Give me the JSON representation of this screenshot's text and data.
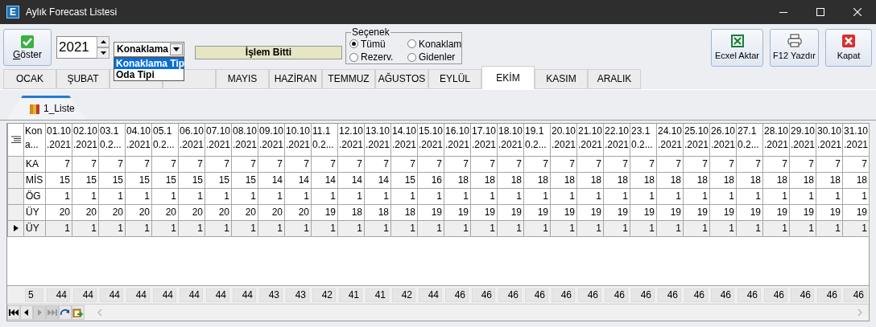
{
  "window": {
    "icon_text": "E",
    "title": "Aylık Forecast Listesi"
  },
  "toolbar": {
    "show_button": "Göster",
    "year": "2021",
    "combo": {
      "value": "Konaklama",
      "expanded": true,
      "options": [
        {
          "label": "Konaklama Tip",
          "selected": true
        },
        {
          "label": "Oda Tipi",
          "selected": false
        }
      ]
    },
    "status": "İşlem Bitti",
    "options_group": {
      "title": "Seçenek",
      "radios": [
        {
          "label": "Tümü",
          "selected": true
        },
        {
          "label": "Konaklam",
          "selected": false
        },
        {
          "label": "Rezerv.",
          "selected": false
        },
        {
          "label": "Gidenler",
          "selected": false
        }
      ]
    },
    "buttons": [
      "Ecxel Aktar",
      "F12 Yazdır",
      "Kapat"
    ]
  },
  "month_tabs": [
    {
      "label": "OCAK",
      "selected": false
    },
    {
      "label": "ŞUBAT",
      "selected": false
    },
    {
      "selected": false
    },
    {
      "selected": false
    },
    {
      "label": "MAYIS",
      "selected": false
    },
    {
      "label": "HAZİRAN",
      "selected": false
    },
    {
      "label": "TEMMUZ",
      "selected": false
    },
    {
      "label": "AĞUSTOS",
      "selected": false
    },
    {
      "label": "EYLÜL",
      "selected": false
    },
    {
      "label": "EKİM",
      "selected": true
    },
    {
      "label": "KASIM",
      "selected": false
    },
    {
      "label": "ARALIK",
      "selected": false
    }
  ],
  "sub_tabs": [
    {
      "label": "1_Liste",
      "selected": true
    }
  ],
  "grid": {
    "first_column": "Kon\na...",
    "columns": [
      "01.10\n.2021",
      "02.10\n.2021",
      "03.1\n0.2...",
      "04.10\n.2021",
      "05.1\n0.2...",
      "06.10\n.2021",
      "07.10\n.2021",
      "08.10\n.2021",
      "09.10\n.2021",
      "10.10\n.2021",
      "11.1\n0.2...",
      "12.10\n.2021",
      "13.10\n.2021",
      "14.10\n.2021",
      "15.10\n.2021",
      "16.10\n.2021",
      "17.10\n.2021",
      "18.10\n.2021",
      "19.1\n0.2...",
      "20.10\n.2021",
      "21.10\n.2021",
      "22.10\n.2021",
      "23.1\n0.2...",
      "24.10\n.2021",
      "25.10\n.2021",
      "26.10\n.2021",
      "27.1\n0.2...",
      "28.10\n.2021",
      "29.10\n.2021",
      "30.10\n.2021",
      "31.10\n.2021"
    ],
    "rows": [
      {
        "label": "KA",
        "selected": false,
        "values": [
          "7",
          "7",
          "7",
          "7",
          "7",
          "7",
          "7",
          "7",
          "7",
          "7",
          "7",
          "7",
          "7",
          "7",
          "7",
          "7",
          "7",
          "7",
          "7",
          "7",
          "7",
          "7",
          "7",
          "7",
          "7",
          "7",
          "7",
          "7",
          "7",
          "7",
          "7"
        ]
      },
      {
        "label": "MİS",
        "selected": false,
        "values": [
          "15",
          "15",
          "15",
          "15",
          "15",
          "15",
          "15",
          "15",
          "14",
          "14",
          "14",
          "14",
          "14",
          "15",
          "16",
          "18",
          "18",
          "18",
          "18",
          "18",
          "18",
          "18",
          "18",
          "18",
          "18",
          "18",
          "18",
          "18",
          "18",
          "18",
          "18"
        ]
      },
      {
        "label": "ÖG",
        "selected": false,
        "values": [
          "1",
          "1",
          "1",
          "1",
          "1",
          "1",
          "1",
          "1",
          "1",
          "1",
          "1",
          "1",
          "1",
          "1",
          "1",
          "1",
          "1",
          "1",
          "1",
          "1",
          "1",
          "1",
          "1",
          "1",
          "1",
          "1",
          "1",
          "1",
          "1",
          "1",
          "1"
        ]
      },
      {
        "label": "ÜY",
        "selected": false,
        "values": [
          "20",
          "20",
          "20",
          "20",
          "20",
          "20",
          "20",
          "20",
          "20",
          "20",
          "19",
          "18",
          "18",
          "18",
          "19",
          "19",
          "19",
          "19",
          "19",
          "19",
          "19",
          "19",
          "19",
          "19",
          "19",
          "19",
          "19",
          "19",
          "19",
          "19",
          "19"
        ]
      },
      {
        "label": "ÜY",
        "selected": true,
        "values": [
          "1",
          "1",
          "1",
          "1",
          "1",
          "1",
          "1",
          "1",
          "1",
          "1",
          "1",
          "1",
          "1",
          "1",
          "1",
          "1",
          "1",
          "1",
          "1",
          "1",
          "1",
          "1",
          "1",
          "1",
          "1",
          "1",
          "1",
          "1",
          "1",
          "1",
          "1"
        ]
      }
    ],
    "footer": {
      "count": "5",
      "totals": [
        "44",
        "44",
        "44",
        "44",
        "44",
        "44",
        "44",
        "44",
        "43",
        "43",
        "42",
        "41",
        "41",
        "42",
        "44",
        "46",
        "46",
        "46",
        "46",
        "46",
        "46",
        "46",
        "46",
        "46",
        "46",
        "46",
        "46",
        "46",
        "46",
        "46",
        "46"
      ]
    }
  },
  "navigator": {
    "buttons": [
      {
        "disabled": false
      },
      {
        "disabled": false
      },
      {
        "disabled": true
      },
      {
        "disabled": true
      },
      {
        "disabled": false
      },
      {
        "disabled": false
      }
    ]
  }
}
